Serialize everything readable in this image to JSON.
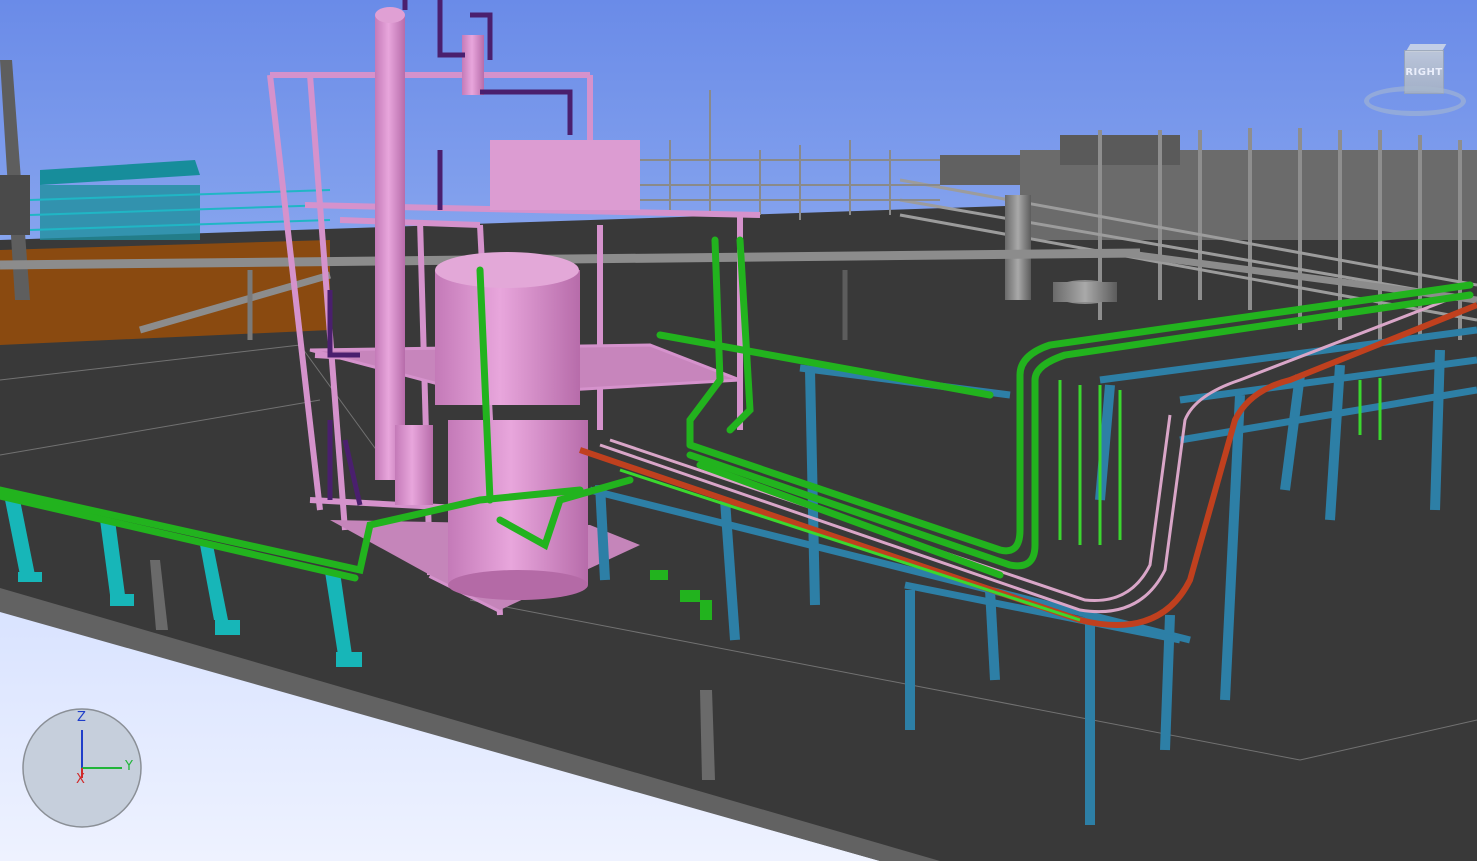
{
  "viewcube": {
    "face_label": "RIGHT"
  },
  "triad": {
    "z_label": "Z",
    "y_label": "Y",
    "x_label": "X"
  },
  "colors": {
    "sky": "#6f8fe6",
    "ground": "#393939",
    "pipe_green": "#22b31e",
    "structure_blue": "#2d7fa6",
    "equipment_pink": "#d68fcc",
    "cable_tray_red": "#c0401e",
    "support_cyan": "#17b6b8"
  }
}
